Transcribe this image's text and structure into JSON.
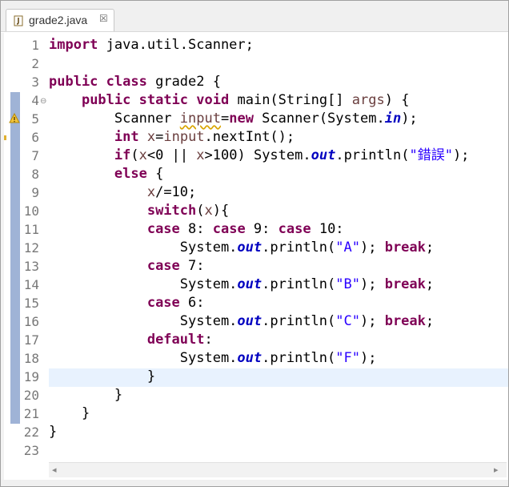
{
  "tab": {
    "title": "grade2.java",
    "close_glyph": "☒",
    "icon": "java-file-icon"
  },
  "line_numbers": [
    "1",
    "2",
    "3",
    "4",
    "5",
    "6",
    "7",
    "8",
    "9",
    "10",
    "11",
    "12",
    "13",
    "14",
    "15",
    "16",
    "17",
    "18",
    "19",
    "20",
    "21",
    "22",
    "23"
  ],
  "fold_marker": "⊖",
  "code": {
    "l1_kw": "import",
    "l1_rest": " java.util.Scanner;",
    "l3_kw1": "public",
    "l3_sp": " ",
    "l3_kw2": "class",
    "l3_rest": " grade2 {",
    "l4_indent": "    ",
    "l4_kw1": "public",
    "l4_kw2": "static",
    "l4_kw3": "void",
    "l4_mid": " main(String[] ",
    "l4_arg": "args",
    "l4_end": ") {",
    "l5_indent": "        ",
    "l5_a": "Scanner ",
    "l5_var": "input",
    "l5_eq": "=",
    "l5_kw": "new",
    "l5_b": " Scanner(System.",
    "l5_fld": "in",
    "l5_end": ");",
    "l6_indent": "        ",
    "l6_kw": "int",
    "l6_sp": " ",
    "l6_x": "x",
    "l6_b": "=",
    "l6_in": "input",
    "l6_end": ".nextInt();",
    "l7_indent": "        ",
    "l7_kw": "if",
    "l7_a": "(",
    "l7_x1": "x",
    "l7_b": "<0 || ",
    "l7_x2": "x",
    "l7_c": ">100) System.",
    "l7_fld": "out",
    "l7_d": ".println(",
    "l7_str": "\"錯誤\"",
    "l7_end": ");",
    "l8_indent": "        ",
    "l8_kw": "else",
    "l8_end": " {",
    "l9_indent": "            ",
    "l9_x": "x",
    "l9_end": "/=10;",
    "l10_indent": "            ",
    "l10_kw": "switch",
    "l10_a": "(",
    "l10_x": "x",
    "l10_end": "){",
    "l11_indent": "            ",
    "l11_kw1": "case",
    "l11_a": " 8: ",
    "l11_kw2": "case",
    "l11_b": " 9: ",
    "l11_kw3": "case",
    "l11_c": " 10:",
    "l12_indent": "                ",
    "l12_a": "System.",
    "l12_fld": "out",
    "l12_b": ".println(",
    "l12_str": "\"A\"",
    "l12_c": "); ",
    "l12_kw": "break",
    "l12_end": ";",
    "l13_indent": "            ",
    "l13_kw": "case",
    "l13_end": " 7:",
    "l14_indent": "                ",
    "l14_a": "System.",
    "l14_fld": "out",
    "l14_b": ".println(",
    "l14_str": "\"B\"",
    "l14_c": "); ",
    "l14_kw": "break",
    "l14_end": ";",
    "l15_indent": "            ",
    "l15_kw": "case",
    "l15_end": " 6:",
    "l16_indent": "                ",
    "l16_a": "System.",
    "l16_fld": "out",
    "l16_b": ".println(",
    "l16_str": "\"C\"",
    "l16_c": "); ",
    "l16_kw": "break",
    "l16_end": ";",
    "l17_indent": "            ",
    "l17_kw": "default",
    "l17_end": ":",
    "l18_indent": "                ",
    "l18_a": "System.",
    "l18_fld": "out",
    "l18_b": ".println(",
    "l18_str": "\"F\"",
    "l18_end": ");",
    "l19": "            }",
    "l20": "        }",
    "l21": "    }",
    "l22": "}"
  },
  "scroll": {
    "left": "◂",
    "right": "▸"
  },
  "colors": {
    "keyword": "#7f0055",
    "string": "#2a00ff",
    "field": "#0000c0",
    "current_line": "#e8f2fe"
  }
}
